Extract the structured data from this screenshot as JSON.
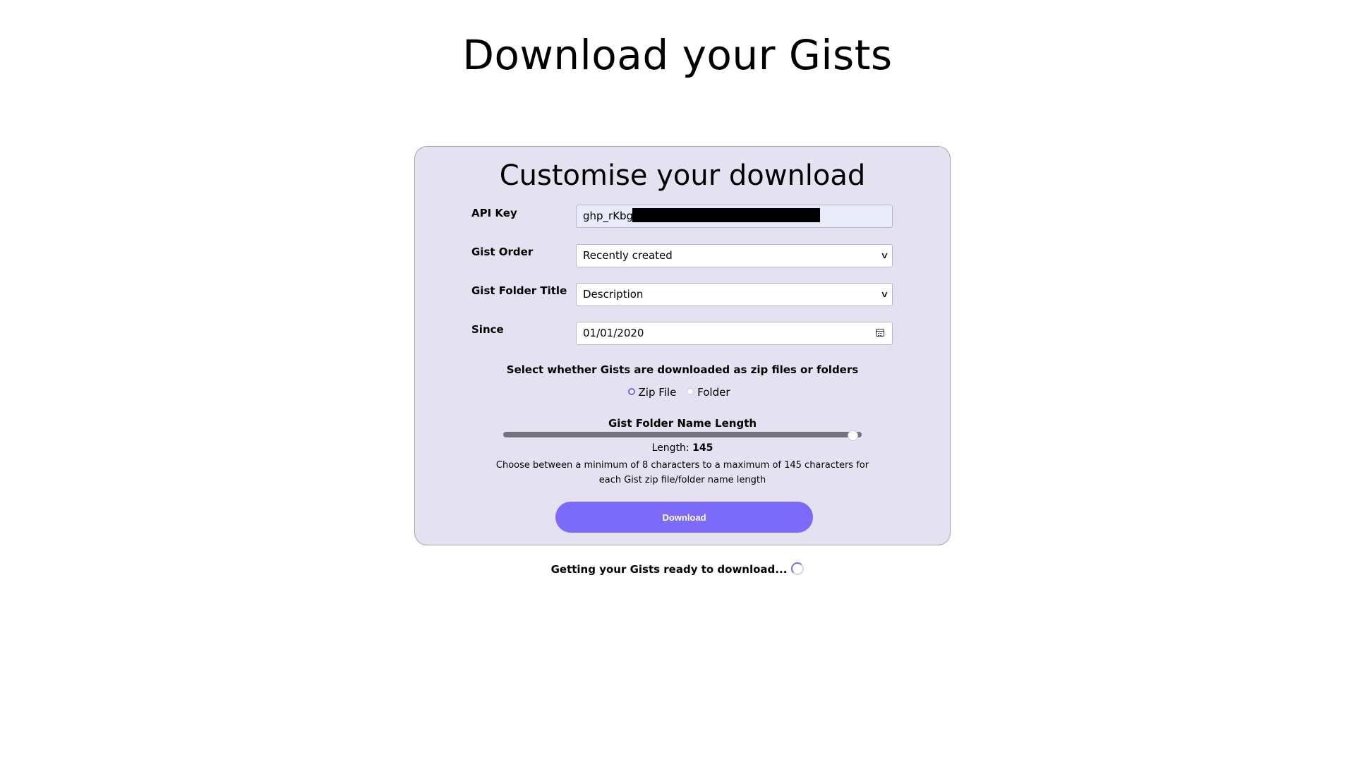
{
  "page": {
    "title": "Download your Gists"
  },
  "card": {
    "title": "Customise your download",
    "api_key": {
      "label": "API Key",
      "value": "ghp_rKbg"
    },
    "gist_order": {
      "label": "Gist Order",
      "selected": "Recently created"
    },
    "folder_title": {
      "label": "Gist Folder Title",
      "selected": "Description"
    },
    "since": {
      "label": "Since",
      "value": "01/01/2020"
    },
    "format": {
      "prompt": "Select whether Gists are downloaded as zip files or folders",
      "options": [
        "Zip File",
        "Folder"
      ],
      "selected": "Zip File"
    },
    "name_length": {
      "label": "Gist Folder Name Length",
      "length_prefix": "Length:",
      "value": "145",
      "min": 8,
      "max": 145,
      "help_line1": "Choose between a minimum of 8 characters to a maximum of 145 characters for",
      "help_line2": "each Gist zip file/folder name length"
    },
    "download_label": "Download"
  },
  "status": {
    "text": "Getting your Gists ready to download..."
  },
  "colors": {
    "accent": "#7c6bfa",
    "card_bg": "#e4e2f0"
  }
}
